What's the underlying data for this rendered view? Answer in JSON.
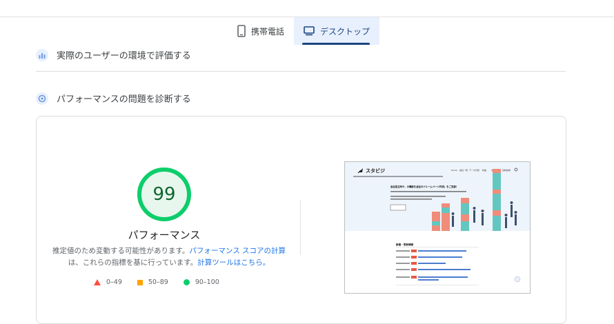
{
  "tabs": [
    {
      "label": "携帯電話",
      "icon": "mobile-phone-icon",
      "active": false
    },
    {
      "label": "デスクトップ",
      "icon": "desktop-monitor-icon",
      "active": true
    }
  ],
  "sections": {
    "field_data": "実際のユーザーの環境で評価する",
    "diagnose": "パフォーマンスの問題を診断する"
  },
  "score": {
    "value": "99",
    "label": "パフォーマンス",
    "fraction": 0.99,
    "color": "#0cce6b"
  },
  "description": {
    "text1": "推定値のため変動する可能性があります。",
    "link1": "パフォーマンス スコアの計算",
    "text2": "は、これらの指標を基に行っています。",
    "link2": "計算ツールはこちら。"
  },
  "legend": [
    {
      "range": "0–49",
      "color": "#ff4e42"
    },
    {
      "range": "50–89",
      "color": "#ffa400"
    },
    {
      "range": "90–100",
      "color": "#0cce6b"
    }
  ],
  "screenshot": {
    "brand": "スタビジ",
    "nav": [
      "Home",
      "会社一覧",
      "データ分析",
      "料金",
      "お問合せ",
      "資料請求"
    ],
    "headline": "会社設立時や、の機能を会社のドルームページ作成」をご支援！",
    "news_title": "新着・更新情報"
  }
}
